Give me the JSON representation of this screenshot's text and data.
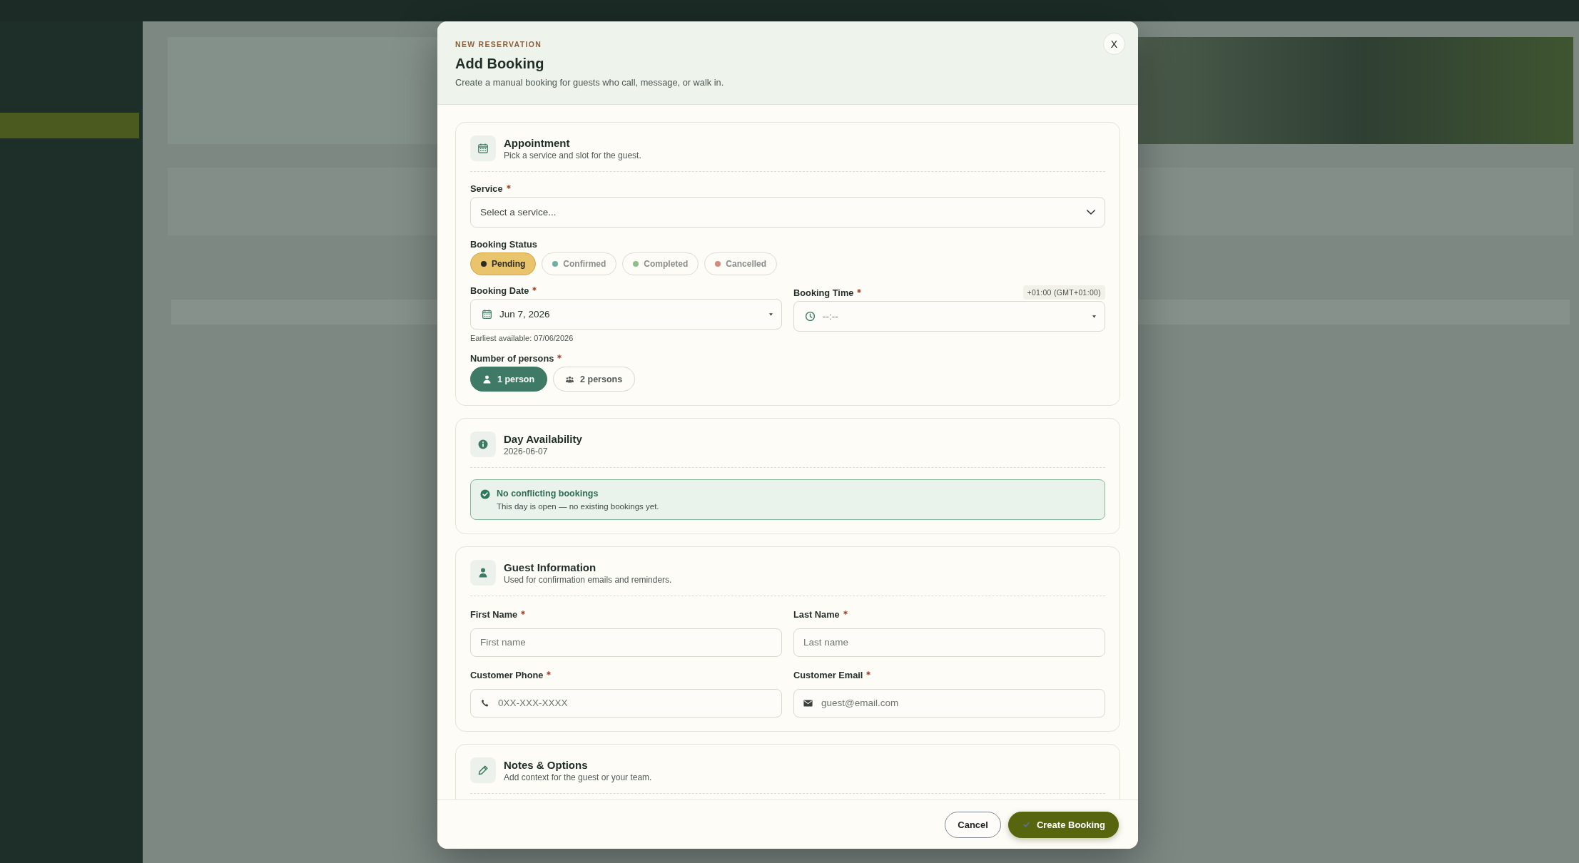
{
  "modal": {
    "eyebrow": "NEW RESERVATION",
    "title": "Add Booking",
    "subtitle": "Create a manual booking for guests who call, message, or walk in.",
    "close": "X"
  },
  "sections": [
    {
      "kind": "appointment",
      "title": "Appointment",
      "subtitle": "Pick a service and slot for the guest.",
      "service": {
        "label": "Service",
        "required": true,
        "placeholder": "Select a service..."
      },
      "status": {
        "label": "Booking Status",
        "options": [
          {
            "label": "Pending",
            "color": "#2b2b25",
            "selected": true
          },
          {
            "label": "Confirmed",
            "color": "#6eb0a0",
            "selected": false
          },
          {
            "label": "Completed",
            "color": "#8cbf88",
            "selected": false
          },
          {
            "label": "Cancelled",
            "color": "#d58a7c",
            "selected": false
          }
        ]
      },
      "date": {
        "label": "Booking Date",
        "required": true,
        "value": "Jun 7, 2026",
        "hint": "Earliest available: 07/06/2026"
      },
      "time": {
        "label": "Booking Time",
        "required": true,
        "timezone": "+01:00 (GMT+01:00)",
        "placeholder": "--:--"
      },
      "persons": {
        "label": "Number of persons",
        "required": true,
        "options": [
          {
            "kind": "single",
            "label": "1 person",
            "selected": true
          },
          {
            "kind": "group",
            "label": "2 persons",
            "selected": false
          }
        ]
      }
    },
    {
      "kind": "availability",
      "title": "Day Availability",
      "subtitle": "2026-06-07",
      "alert": {
        "title": "No conflicting bookings",
        "text": "This day is open — no existing bookings yet."
      }
    },
    {
      "kind": "guest",
      "title": "Guest Information",
      "subtitle": "Used for confirmation emails and reminders.",
      "fields": [
        {
          "kind": "text",
          "label": "First Name",
          "required": true,
          "placeholder": "First name"
        },
        {
          "kind": "text",
          "label": "Last Name",
          "required": true,
          "placeholder": "Last name"
        },
        {
          "kind": "phone",
          "label": "Customer Phone",
          "required": true,
          "placeholder": "0XX-XXX-XXXX"
        },
        {
          "kind": "email",
          "label": "Customer Email",
          "required": true,
          "placeholder": "guest@email.com"
        }
      ]
    },
    {
      "kind": "notes",
      "title": "Notes & Options",
      "subtitle": "Add context for the guest or your team."
    }
  ],
  "footer": {
    "buttons": [
      {
        "kind": "secondary",
        "label": "Cancel"
      },
      {
        "kind": "primary",
        "label": "Create Booking"
      }
    ]
  }
}
